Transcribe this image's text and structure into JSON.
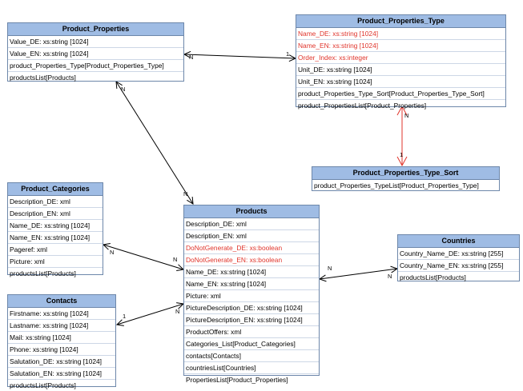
{
  "colors": {
    "header_fill": "#9fbce4",
    "border": "#6d87aa",
    "required_text": "#e0342b",
    "edge": "#000000",
    "sort_edge": "#e0342b"
  },
  "entities": {
    "product_properties": {
      "title": "Product_Properties",
      "rows": [
        {
          "text": "Value_DE: xs:string [1024]",
          "required": false
        },
        {
          "text": "Value_EN: xs:string [1024]",
          "required": false
        },
        {
          "text": "product_Properties_Type[Product_Properties_Type]",
          "required": false
        },
        {
          "text": "productsList[Products]",
          "required": false
        }
      ]
    },
    "product_properties_type": {
      "title": "Product_Properties_Type",
      "rows": [
        {
          "text": "Name_DE: xs:string [1024]",
          "required": true
        },
        {
          "text": "Name_EN: xs:string [1024]",
          "required": true
        },
        {
          "text": "Order_Index: xs:integer",
          "required": true
        },
        {
          "text": "Unit_DE: xs:string [1024]",
          "required": false
        },
        {
          "text": "Unit_EN: xs:string [1024]",
          "required": false
        },
        {
          "text": "product_Properties_Type_Sort[Product_Properties_Type_Sort]",
          "required": false
        },
        {
          "text": "product_PropertiesList[Product_Properties]",
          "required": false
        }
      ]
    },
    "product_properties_type_sort": {
      "title": "Product_Properties_Type_Sort",
      "rows": [
        {
          "text": "product_Properties_TypeList[Product_Properties_Type]",
          "required": false
        }
      ]
    },
    "product_categories": {
      "title": "Product_Categories",
      "rows": [
        {
          "text": "Description_DE: xml",
          "required": false
        },
        {
          "text": "Description_EN: xml",
          "required": false
        },
        {
          "text": "Name_DE: xs:string [1024]",
          "required": false
        },
        {
          "text": "Name_EN: xs:string [1024]",
          "required": false
        },
        {
          "text": "Pageref: xml",
          "required": false
        },
        {
          "text": "Picture: xml",
          "required": false
        },
        {
          "text": "productsList[Products]",
          "required": false
        }
      ]
    },
    "products": {
      "title": "Products",
      "rows": [
        {
          "text": "Description_DE: xml",
          "required": false
        },
        {
          "text": "Description_EN: xml",
          "required": false
        },
        {
          "text": "DoNotGenerate_DE: xs:boolean",
          "required": true
        },
        {
          "text": "DoNotGenerate_EN: xs:boolean",
          "required": true
        },
        {
          "text": "Name_DE: xs:string [1024]",
          "required": false
        },
        {
          "text": "Name_EN: xs:string [1024]",
          "required": false
        },
        {
          "text": "Picture: xml",
          "required": false
        },
        {
          "text": "PictureDescription_DE: xs:string [1024]",
          "required": false
        },
        {
          "text": "PictureDescription_EN: xs:string [1024]",
          "required": false
        },
        {
          "text": "ProductOffers: xml",
          "required": false
        },
        {
          "text": "Categories_List[Product_Categories]",
          "required": false
        },
        {
          "text": "contacts[Contacts]",
          "required": false
        },
        {
          "text": "countriesList[Countries]",
          "required": false
        },
        {
          "text": "PropertiesList[Product_Properties]",
          "required": false
        }
      ]
    },
    "countries": {
      "title": "Countries",
      "rows": [
        {
          "text": "Country_Name_DE: xs:string [255]",
          "required": false
        },
        {
          "text": "Country_Name_EN: xs:string [255]",
          "required": false
        },
        {
          "text": "productsList[Products]",
          "required": false
        }
      ]
    },
    "contacts": {
      "title": "Contacts",
      "rows": [
        {
          "text": "Firstname: xs:string [1024]",
          "required": false
        },
        {
          "text": "Lastname: xs:string [1024]",
          "required": false
        },
        {
          "text": "Mail: xs:string [1024]",
          "required": false
        },
        {
          "text": "Phone: xs:string [1024]",
          "required": false
        },
        {
          "text": "Salutation_DE: xs:string [1024]",
          "required": false
        },
        {
          "text": "Salutation_EN: xs:string [1024]",
          "required": false
        },
        {
          "text": "productsList[Products]",
          "required": false
        }
      ]
    }
  },
  "relations": {
    "props_to_type": {
      "source_mult": "N",
      "target_mult": "1"
    },
    "type_to_sort": {
      "source_mult": "N",
      "target_mult": "1"
    },
    "props_to_products": {
      "source_mult": "N",
      "target_mult": "N"
    },
    "categories_to_products": {
      "source_mult": "N",
      "target_mult": "N"
    },
    "products_to_countries": {
      "source_mult": "N",
      "target_mult": "N"
    },
    "contacts_to_products": {
      "source_mult": "1",
      "target_mult": "N"
    }
  }
}
